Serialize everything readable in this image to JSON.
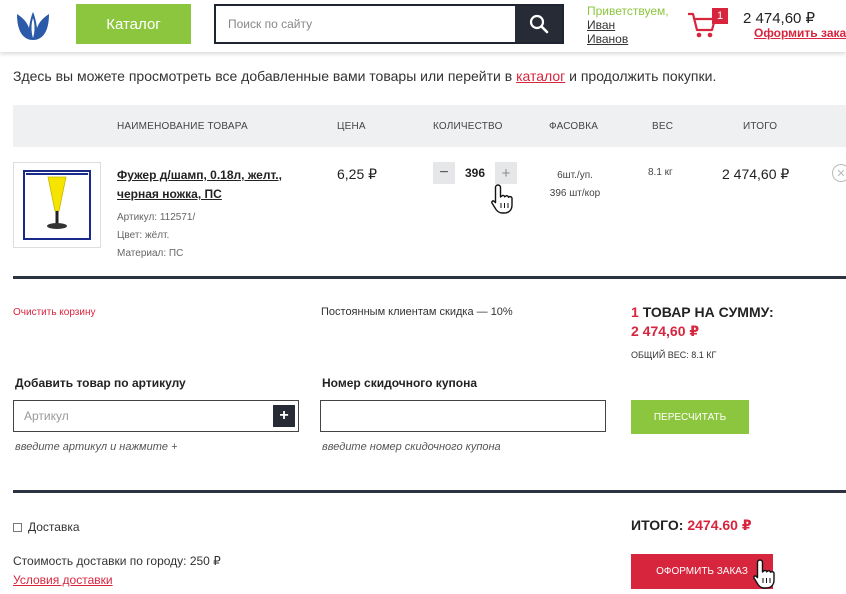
{
  "header": {
    "catalog_label": "Каталог",
    "search_placeholder": "Поиск по сайту",
    "greeting": "Приветствуем,",
    "user_first": "Иван",
    "user_last": "Иванов",
    "cart_count": "1",
    "cart_total": "2 474,60 ₽",
    "checkout_link": "Оформить заказ"
  },
  "intro": {
    "before": "Здесь вы можете просмотреть все добавленные вами товары или перейти в ",
    "link": "каталог",
    "after": " и продолжить покупки."
  },
  "table": {
    "headers": {
      "name": "Наименование товара",
      "price": "Цена",
      "qty": "Количество",
      "pack": "Фасовка",
      "weight": "Вес",
      "total": "Итого"
    },
    "item": {
      "name": "Фужер д/шамп, 0.18л, желт., черная ножка, ПС",
      "article": "Артикул: 112571/",
      "color": "Цвет: жёлт.",
      "material": "Материал: ПС",
      "price": "6,25 ₽",
      "qty_minus": "−",
      "quantity": "396",
      "qty_plus": "+",
      "pack_1": "6шт./уп.",
      "pack_2": "396 шт/кор",
      "weight": "8.1 кг",
      "total": "2 474,60 ₽"
    }
  },
  "summary": {
    "clear_cart": "Очистить корзину",
    "discount_text": "Постоянным клиентам скидка — 10%",
    "item_count": "1",
    "sum_label": "ТОВАР НА СУММУ:",
    "sum_value": "2 474,60 ₽",
    "total_weight": "ОБЩИЙ ВЕС: 8.1 КГ"
  },
  "forms": {
    "article_label": "Добавить товар по артикулу",
    "article_placeholder": "Артикул",
    "article_add": "+",
    "article_hint": "введите артикул и нажмите +",
    "coupon_label": "Номер скидочного купона",
    "coupon_placeholder": "",
    "coupon_hint": "введите номер скидочного купона",
    "recalc_label": "ПЕРЕСЧИТАТЬ"
  },
  "delivery": {
    "label": "Доставка",
    "city_cost": "Стоимость доставки по городу: 250 ₽",
    "terms_link": "Условия доставки"
  },
  "checkout": {
    "total_label": "ИТОГО:",
    "total_value": "2474.60 ₽",
    "order_button": "ОФОРМИТЬ ЗАКАЗ"
  },
  "colors": {
    "green": "#8cc63f",
    "red": "#d8253e",
    "dark": "#262b36",
    "head_bg": "#eef0f2"
  },
  "icons": {
    "logo": "tulip-logo-icon",
    "search": "search-icon",
    "cart": "cart-icon",
    "remove": "close-circle-icon",
    "cursor": "hand-pointer-icon"
  }
}
